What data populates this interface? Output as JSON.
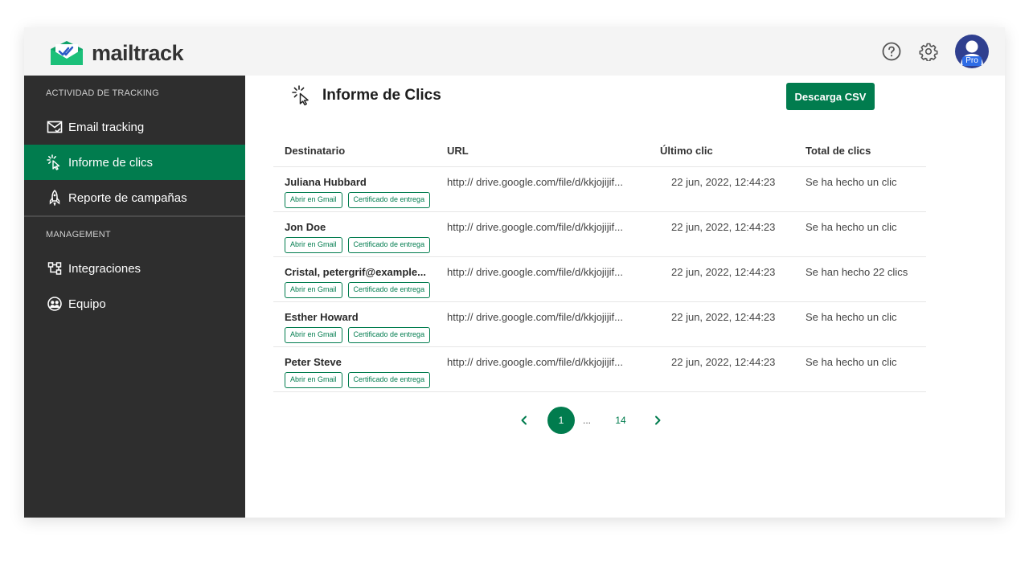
{
  "app": {
    "brand": "mailtrack"
  },
  "header": {
    "pro_badge": "Pro",
    "help_icon": "help-circle-icon",
    "settings_icon": "gear-icon"
  },
  "colors": {
    "accent": "#017c4e",
    "sidebar_bg": "#2e2e2e",
    "topbar_bg": "#f4f4f4",
    "avatar_bg": "#2f3f8f",
    "badge": "#2e6ce6"
  },
  "sidebar": {
    "section1": "ACTIVIDAD DE TRACKING",
    "items1": [
      {
        "label": "Email tracking",
        "icon": "envelope-check-icon"
      },
      {
        "label": "Informe de clics",
        "icon": "click-cursor-icon",
        "active": true
      },
      {
        "label": "Reporte de campañas",
        "icon": "rocket-icon"
      }
    ],
    "section2": "MANAGEMENT",
    "items2": [
      {
        "label": "Integraciones",
        "icon": "integrations-icon"
      },
      {
        "label": "Equipo",
        "icon": "team-icon"
      }
    ]
  },
  "main": {
    "title": "Informe de Clics",
    "csv_button": "Descarga CSV",
    "columns": [
      "Destinatario",
      "URL",
      "Último clic",
      "Total de clics"
    ],
    "tag_gmail": "Abrir en Gmail",
    "tag_cert": "Certificado de entrega",
    "rows": [
      {
        "name": "Juliana Hubbard",
        "url": "http:// drive.google.com/file/d/kkjojijif...",
        "last": "22 jun, 2022, 12:44:23",
        "total": "Se ha hecho un clic"
      },
      {
        "name": "Jon Doe",
        "url": "http:// drive.google.com/file/d/kkjojijif...",
        "last": "22 jun, 2022, 12:44:23",
        "total": "Se ha hecho un clic"
      },
      {
        "name": "Cristal, petergrif@example...",
        "url": "http:// drive.google.com/file/d/kkjojijif...",
        "last": "22 jun, 2022, 12:44:23",
        "total": "Se han hecho 22 clics"
      },
      {
        "name": "Esther Howard",
        "url": "http:// drive.google.com/file/d/kkjojijif...",
        "last": "22 jun, 2022, 12:44:23",
        "total": "Se ha hecho un clic"
      },
      {
        "name": "Peter Steve",
        "url": "http:// drive.google.com/file/d/kkjojijif...",
        "last": "22 jun, 2022, 12:44:23",
        "total": "Se ha hecho un clic"
      }
    ]
  },
  "pagination": {
    "current": "1",
    "dots": "...",
    "last": "14"
  }
}
